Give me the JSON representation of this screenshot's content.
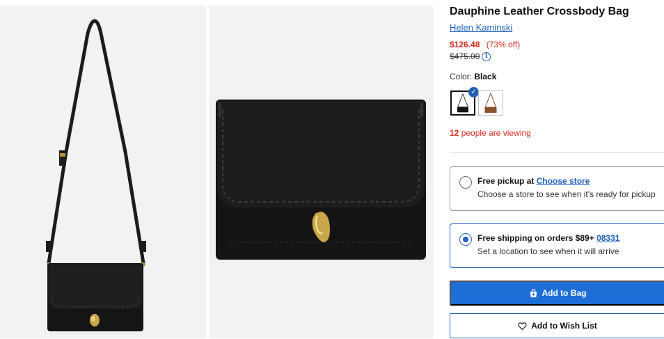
{
  "product": {
    "title": "Dauphine Leather Crossbody Bag",
    "brand": "Helen Kaminski",
    "sale_price": "$126.48",
    "discount": "(73% off)",
    "original_price": "$475.00",
    "info_icon": "i"
  },
  "color": {
    "label": "Color:",
    "selected": "Black",
    "swatches": [
      "Black",
      "Brown"
    ]
  },
  "viewing": {
    "count": "12",
    "text": "people are viewing"
  },
  "fulfillment": {
    "pickup": {
      "title": "Free pickup at",
      "link": "Choose store",
      "subtitle": "Choose a store to see when it's ready for pickup",
      "selected": false
    },
    "shipping": {
      "title": "Free shipping on orders $89+",
      "link": "08331",
      "subtitle": "Set a location to see when it will arrive",
      "selected": true
    }
  },
  "actions": {
    "add_to_bag": "Add to Bag",
    "add_to_wishlist": "Add to Wish List"
  },
  "colors": {
    "accent": "#2161b8",
    "button": "#1e6ed8",
    "sale": "#d12a1c"
  }
}
